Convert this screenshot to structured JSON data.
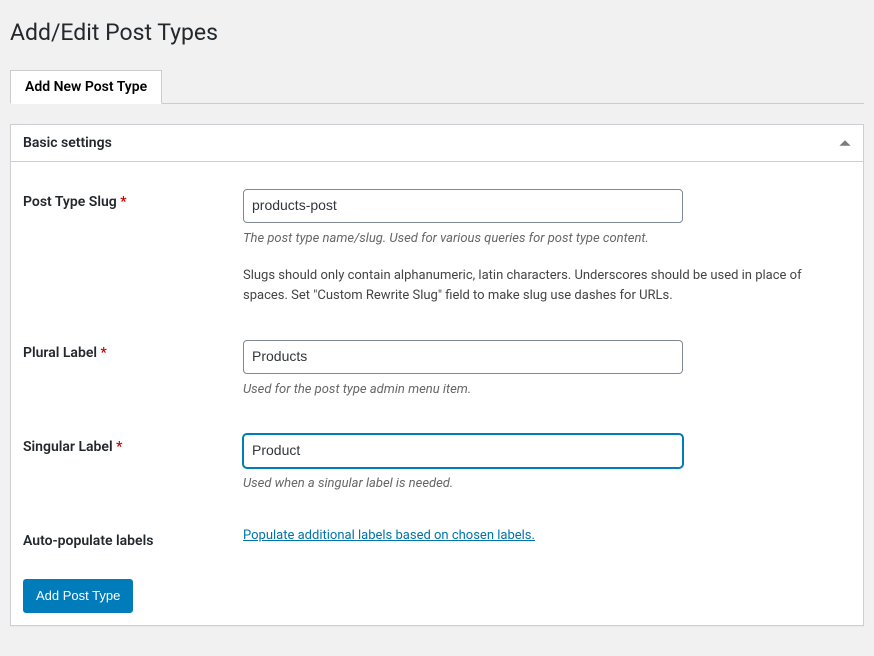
{
  "page": {
    "title": "Add/Edit Post Types"
  },
  "tabs": {
    "add_new": "Add New Post Type"
  },
  "panel": {
    "title": "Basic settings"
  },
  "fields": {
    "slug": {
      "label": "Post Type Slug",
      "value": "products-post",
      "desc1": "The post type name/slug. Used for various queries for post type content.",
      "desc2": "Slugs should only contain alphanumeric, latin characters. Underscores should be used in place of spaces. Set \"Custom Rewrite Slug\" field to make slug use dashes for URLs."
    },
    "plural": {
      "label": "Plural Label",
      "value": "Products",
      "desc": "Used for the post type admin menu item."
    },
    "singular": {
      "label": "Singular Label",
      "value": "Product",
      "desc": "Used when a singular label is needed."
    },
    "autopopulate": {
      "label": "Auto-populate labels",
      "link": "Populate additional labels based on chosen labels."
    }
  },
  "actions": {
    "submit": "Add Post Type"
  },
  "required_marker": "*"
}
